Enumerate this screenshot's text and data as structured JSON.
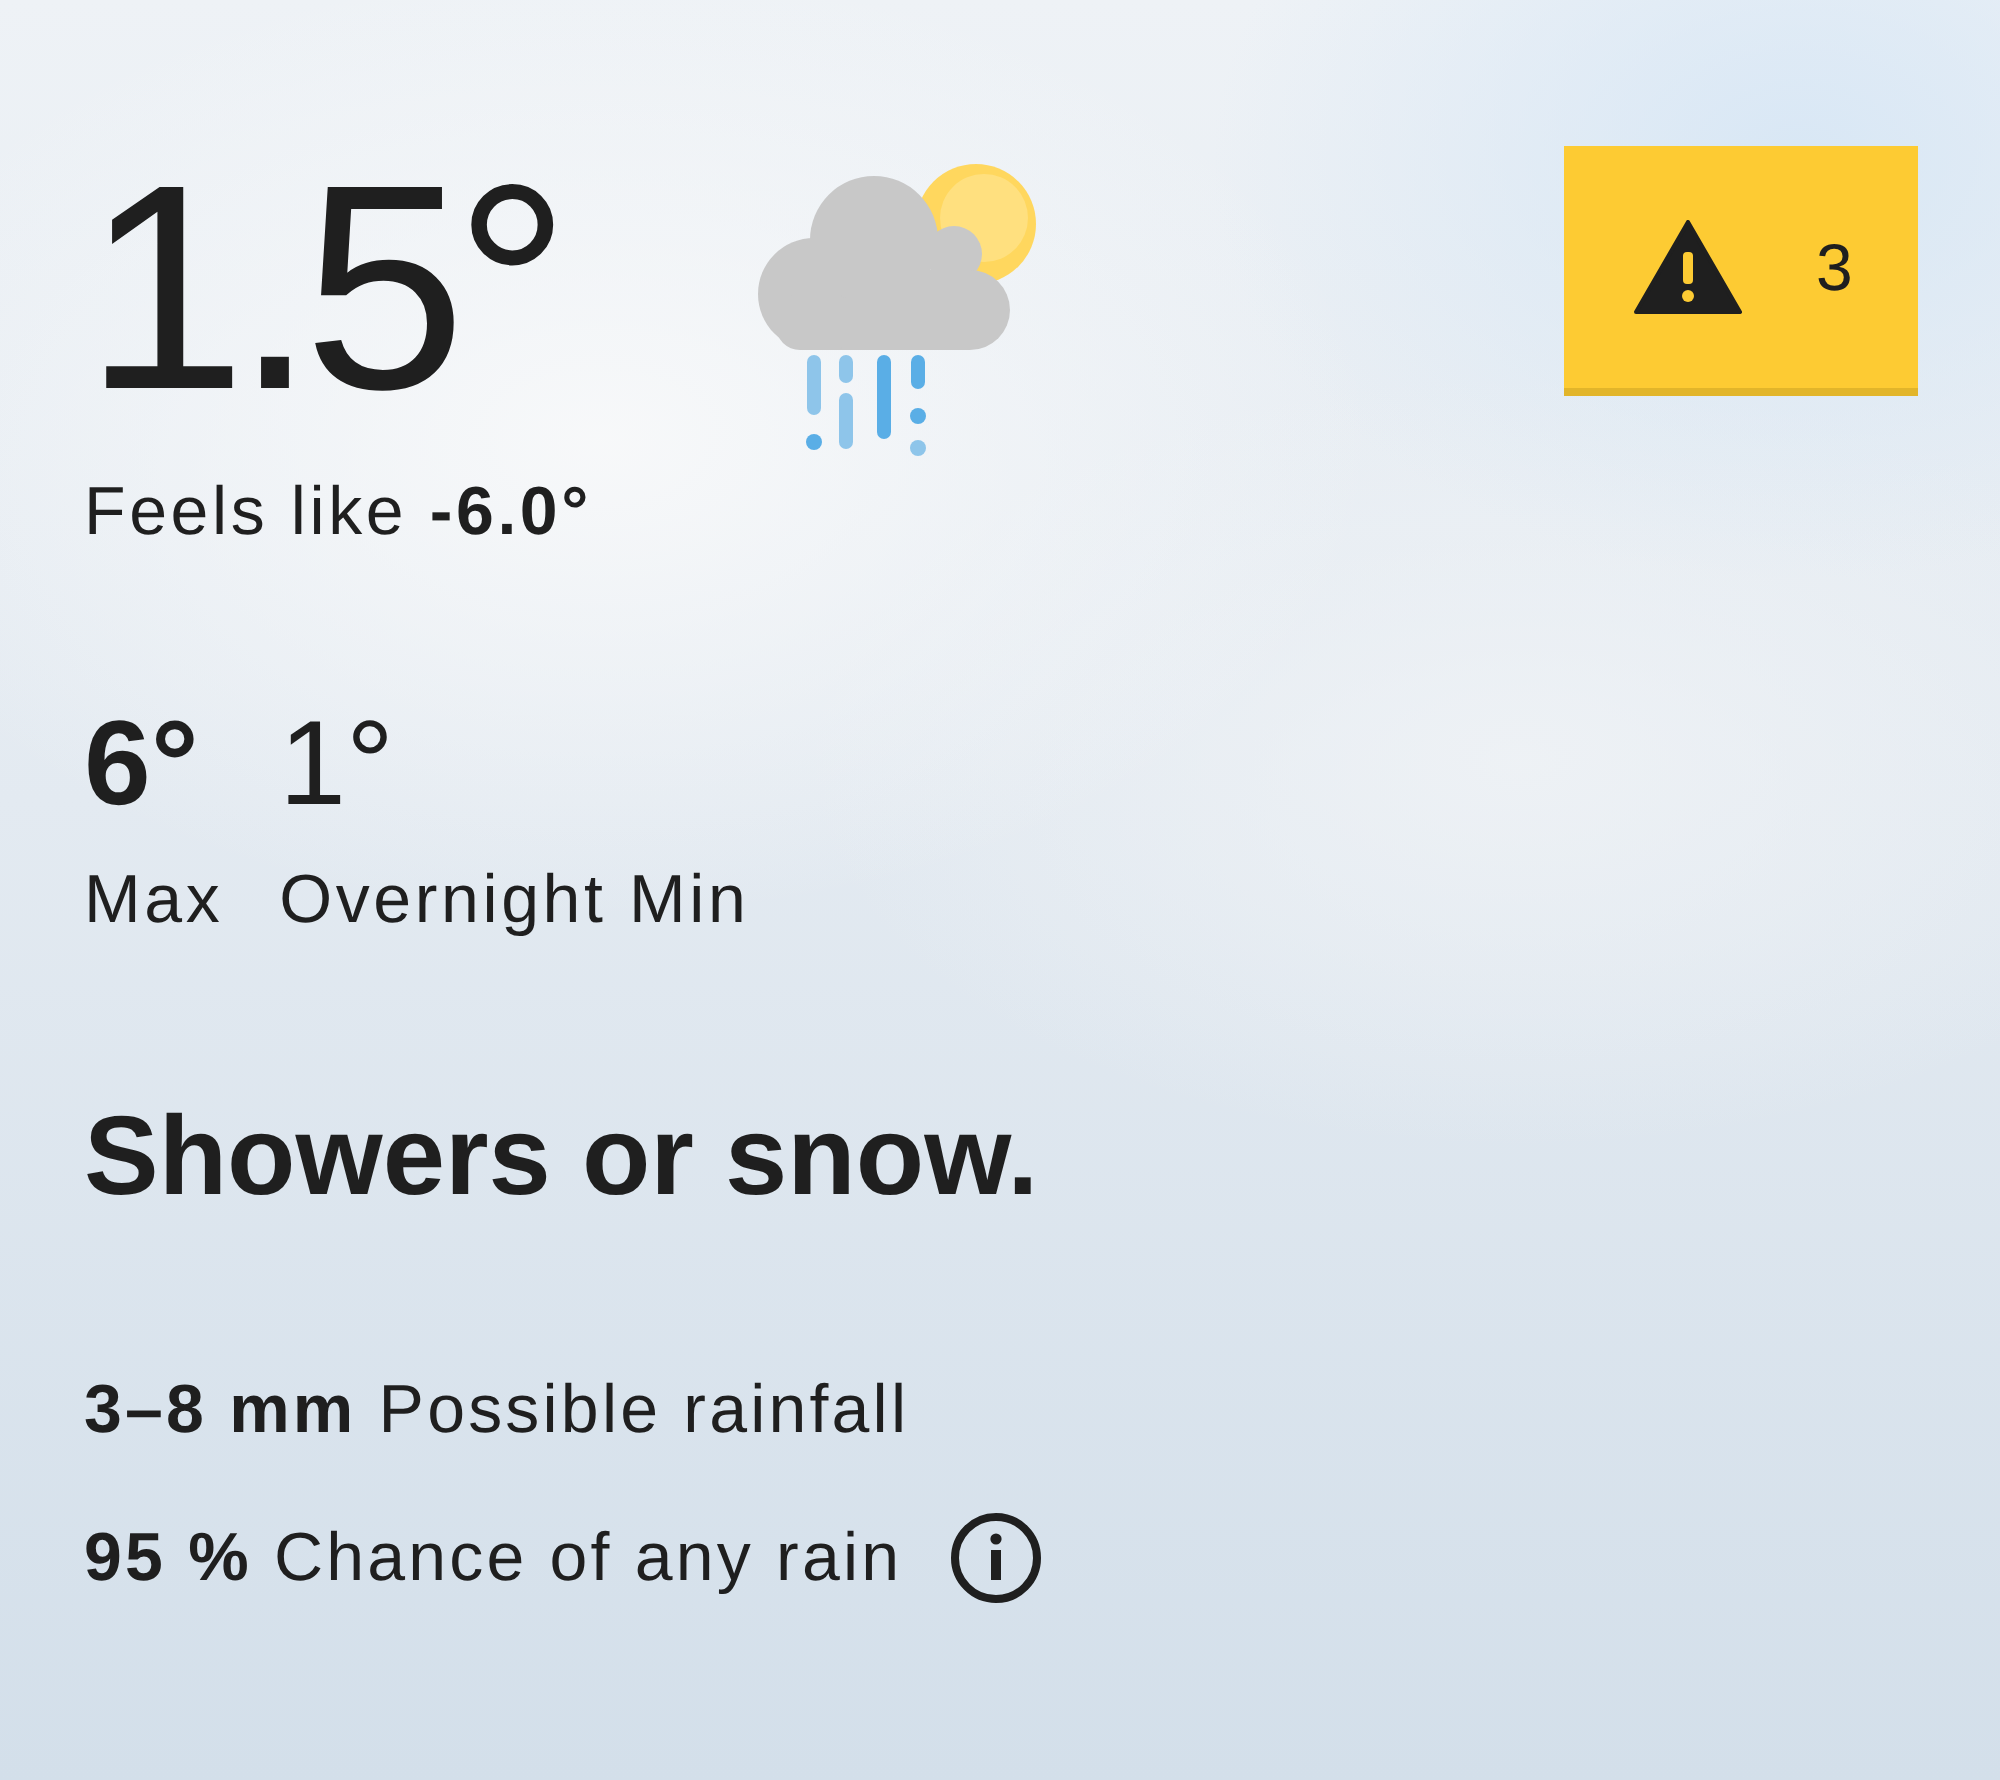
{
  "current": {
    "temperature": "1.5°",
    "feels_like": "Feels like **-6.0°**"
  },
  "warnings": {
    "count": "3"
  },
  "forecast": {
    "max": {
      "value": "6°",
      "label": "Max"
    },
    "min": {
      "value": "1°",
      "label": "Overnight Min"
    }
  },
  "summary": "Showers or snow.",
  "rain": {
    "amount": "**3–8 mm** Possible rainfall",
    "chance": "**95 %** Chance of any rain"
  }
}
